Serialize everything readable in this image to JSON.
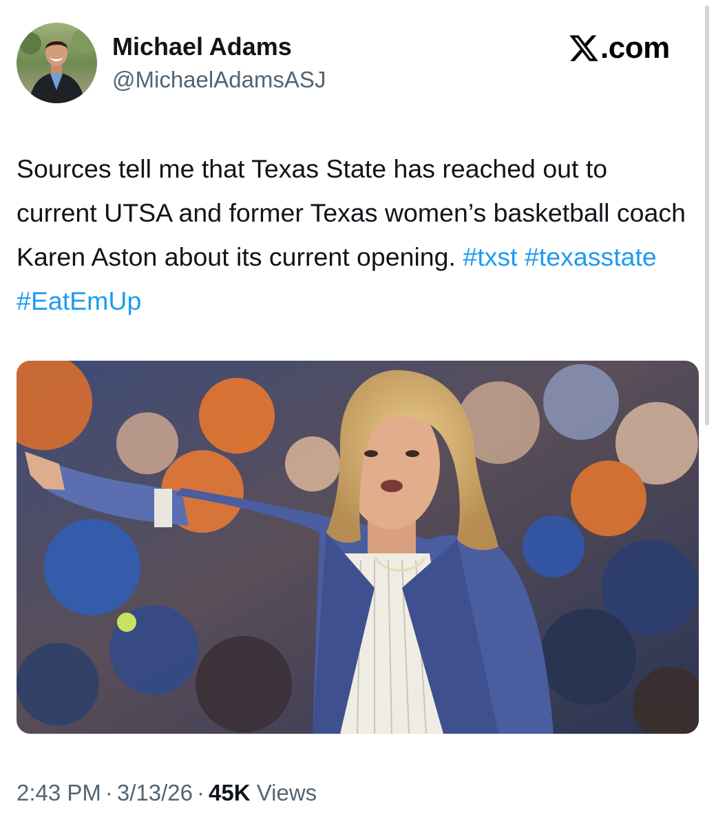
{
  "author": {
    "display_name": "Michael Adams",
    "handle": "@MichaelAdamsASJ"
  },
  "brand": {
    "logo_icon": "x-logo-icon",
    "domain": ".com"
  },
  "tweet": {
    "text": "Sources tell me that Texas State has reached out to current UTSA and former Texas women’s basketball coach Karen Aston about its current opening.",
    "hashtags": [
      "#txst",
      "#texasstate",
      "#EatEmUp"
    ]
  },
  "meta": {
    "time": "2:43 PM",
    "separator": "·",
    "date": "3/13/26",
    "views_count": "45K",
    "views_label": "Views"
  },
  "colors": {
    "hashtag": "#1d9bf0",
    "secondary_text": "#536471",
    "primary_text": "#0f1419"
  }
}
